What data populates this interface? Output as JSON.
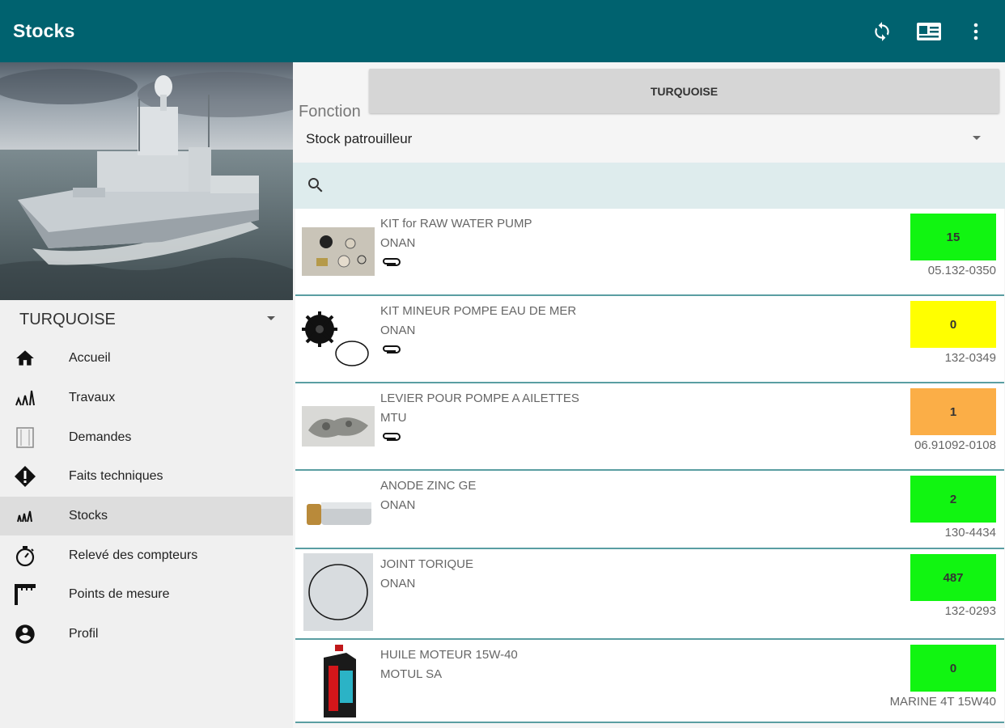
{
  "appbar": {
    "title": "Stocks",
    "actions": [
      {
        "icon": "sync-icon"
      },
      {
        "icon": "id-card-icon"
      },
      {
        "icon": "more-vert-icon"
      }
    ]
  },
  "drawer": {
    "site_selector": "TURQUOISE",
    "items": [
      {
        "label": "Accueil",
        "icon": "home-icon",
        "active": false
      },
      {
        "label": "Travaux",
        "icon": "works-icon",
        "active": false
      },
      {
        "label": "Demandes",
        "icon": "requests-icon",
        "active": false
      },
      {
        "label": "Faits techniques",
        "icon": "alert-diamond-icon",
        "active": false
      },
      {
        "label": "Stocks",
        "icon": "stocks-icon",
        "active": true
      },
      {
        "label": "Relevé des compteurs",
        "icon": "stopwatch-icon",
        "active": false
      },
      {
        "label": "Points de mesure",
        "icon": "measure-point-icon",
        "active": false
      },
      {
        "label": "Profil",
        "icon": "account-icon",
        "active": false
      }
    ]
  },
  "main": {
    "site_button": "TURQUOISE",
    "function_label": "Fonction",
    "function_value": "Stock patrouilleur",
    "search_placeholder": ""
  },
  "stock_items": [
    {
      "name": "KIT for RAW WATER PUMP",
      "maker": "ONAN",
      "has_attachment": true,
      "quantity": "15",
      "qty_color": "#11f511",
      "reference": "05.132-0350",
      "thumb": "kit-parts-thumbnail"
    },
    {
      "name": "KIT MINEUR POMPE EAU DE MER",
      "maker": "ONAN",
      "has_attachment": true,
      "quantity": "0",
      "qty_color": "#ffff00",
      "reference": "132-0349",
      "thumb": "impeller-thumbnail"
    },
    {
      "name": "LEVIER POUR POMPE A AILETTES",
      "maker": "MTU",
      "has_attachment": true,
      "quantity": "1",
      "qty_color": "#fbae47",
      "reference": "06.91092-0108",
      "thumb": "lever-thumbnail"
    },
    {
      "name": "ANODE ZINC GE",
      "maker": "ONAN",
      "has_attachment": false,
      "quantity": "2",
      "qty_color": "#11f511",
      "reference": "130-4434",
      "thumb": "anode-thumbnail"
    },
    {
      "name": "JOINT TORIQUE",
      "maker": "ONAN",
      "has_attachment": false,
      "quantity": "487",
      "qty_color": "#11f511",
      "reference": "132-0293",
      "thumb": "o-ring-thumbnail"
    },
    {
      "name": "HUILE MOTEUR 15W-40",
      "maker": "MOTUL SA",
      "has_attachment": false,
      "quantity": "0",
      "qty_color": "#11f511",
      "reference": "MARINE 4T 15W40",
      "thumb": "oil-bottle-thumbnail"
    }
  ],
  "colors": {
    "appbar": "#00626f",
    "divider": "#5a9ea2",
    "search_bg": "#deeced"
  }
}
